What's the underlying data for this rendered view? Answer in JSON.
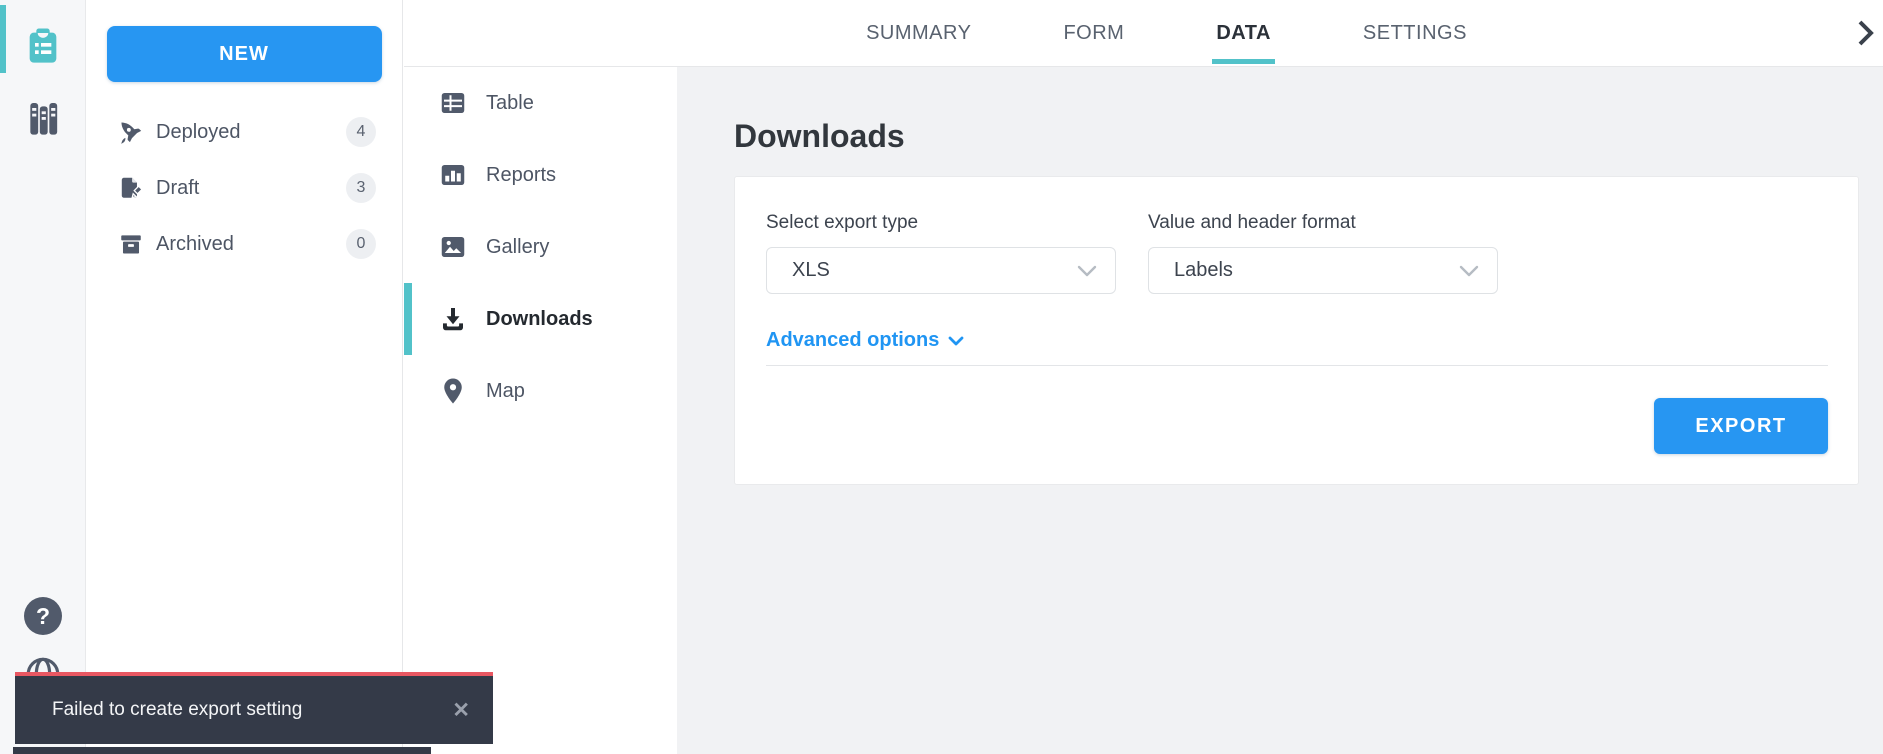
{
  "colors": {
    "accent_blue": "#2796f2",
    "accent_teal": "#52c2c9",
    "icon_slate": "#515a6b",
    "main_bg": "#f1f2f4",
    "toast_bg": "#343a48",
    "toast_error": "#e95762"
  },
  "icon_rail": {
    "forms_item_icon": "clipboard-forms-icon",
    "library_item_icon": "library-icon",
    "help_icon": "help-icon",
    "help_glyph": "?",
    "globe_icon": "globe-icon"
  },
  "forms_sidebar": {
    "new_button_label": "NEW",
    "items": [
      {
        "icon": "rocket-icon",
        "label": "Deployed",
        "count": "4"
      },
      {
        "icon": "draft-pencil-icon",
        "label": "Draft",
        "count": "3"
      },
      {
        "icon": "archive-box-icon",
        "label": "Archived",
        "count": "0"
      }
    ]
  },
  "header": {
    "tabs": [
      {
        "label": "SUMMARY",
        "active": false
      },
      {
        "label": "FORM",
        "active": false
      },
      {
        "label": "DATA",
        "active": true
      },
      {
        "label": "SETTINGS",
        "active": false
      }
    ],
    "collapse_icon": "chevron-right-icon"
  },
  "data_nav": {
    "items": [
      {
        "icon": "table-icon",
        "label": "Table",
        "active": false
      },
      {
        "icon": "reports-chart-icon",
        "label": "Reports",
        "active": false
      },
      {
        "icon": "gallery-image-icon",
        "label": "Gallery",
        "active": false
      },
      {
        "icon": "download-icon",
        "label": "Downloads",
        "active": true
      },
      {
        "icon": "map-pin-icon",
        "label": "Map",
        "active": false
      }
    ]
  },
  "main": {
    "title": "Downloads",
    "export_panel": {
      "type_label": "Select export type",
      "type_value": "XLS",
      "format_label": "Value and header format",
      "format_value": "Labels",
      "advanced_label": "Advanced options",
      "export_button_label": "EXPORT"
    }
  },
  "toast": {
    "message": "Failed to create export setting",
    "close_glyph": "✕"
  }
}
